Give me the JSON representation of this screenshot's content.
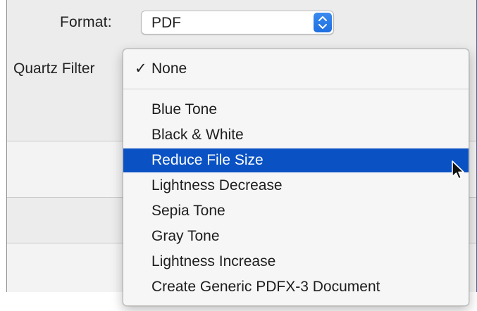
{
  "format": {
    "label": "Format:",
    "value": "PDF",
    "stepper_icon": "up-down-chevron-icon",
    "accent": "#1f6fe0"
  },
  "quartz_filter": {
    "label": "Quartz Filter"
  },
  "menu": {
    "checked_item": {
      "check": "✓",
      "label": "None"
    },
    "items": [
      {
        "label": "Blue Tone"
      },
      {
        "label": "Black & White"
      },
      {
        "label": "Reduce File Size",
        "highlighted": true
      },
      {
        "label": "Lightness Decrease"
      },
      {
        "label": "Sepia Tone"
      },
      {
        "label": "Gray Tone"
      },
      {
        "label": "Lightness Increase"
      },
      {
        "label": "Create Generic PDFX-3 Document"
      }
    ],
    "highlight_color": "#0a52c4"
  },
  "cursor": {
    "icon": "arrow-cursor-icon"
  }
}
